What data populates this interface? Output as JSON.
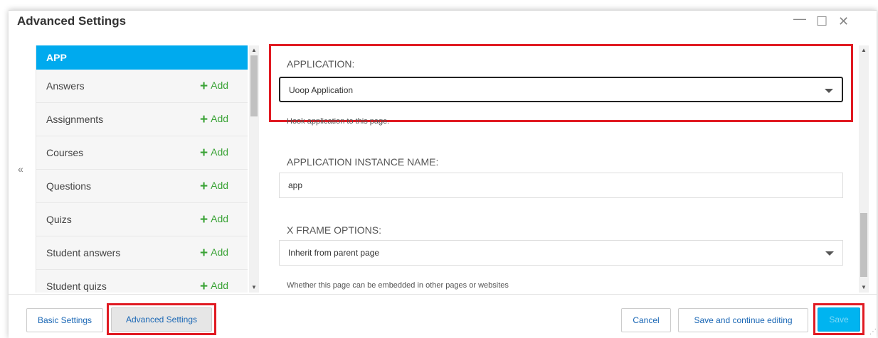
{
  "window": {
    "title": "Advanced Settings",
    "minimize": "—",
    "maximize": "☐",
    "close": "✕"
  },
  "nav": {
    "collapse": "«"
  },
  "entity_list": {
    "header": "APP",
    "add_label": "Add",
    "items": [
      {
        "label": "Answers"
      },
      {
        "label": "Assignments"
      },
      {
        "label": "Courses"
      },
      {
        "label": "Questions"
      },
      {
        "label": "Quizs"
      },
      {
        "label": "Student answers"
      },
      {
        "label": "Student quizs"
      }
    ]
  },
  "form": {
    "application": {
      "label": "APPLICATION:",
      "value": "Uoop Application",
      "hint": "Hook application to this page."
    },
    "instance_name": {
      "label": "APPLICATION INSTANCE NAME:",
      "value": "app"
    },
    "x_frame": {
      "label": "X FRAME OPTIONS:",
      "value": "Inherit from parent page",
      "hint": "Whether this page can be embedded in other pages or websites"
    }
  },
  "footer": {
    "basic_settings": "Basic Settings",
    "advanced_settings": "Advanced Settings",
    "cancel": "Cancel",
    "save_continue": "Save and continue editing",
    "save": "Save"
  },
  "colors": {
    "accent": "#00aaee",
    "highlight": "#e01a22",
    "add_green": "#3aa336"
  }
}
